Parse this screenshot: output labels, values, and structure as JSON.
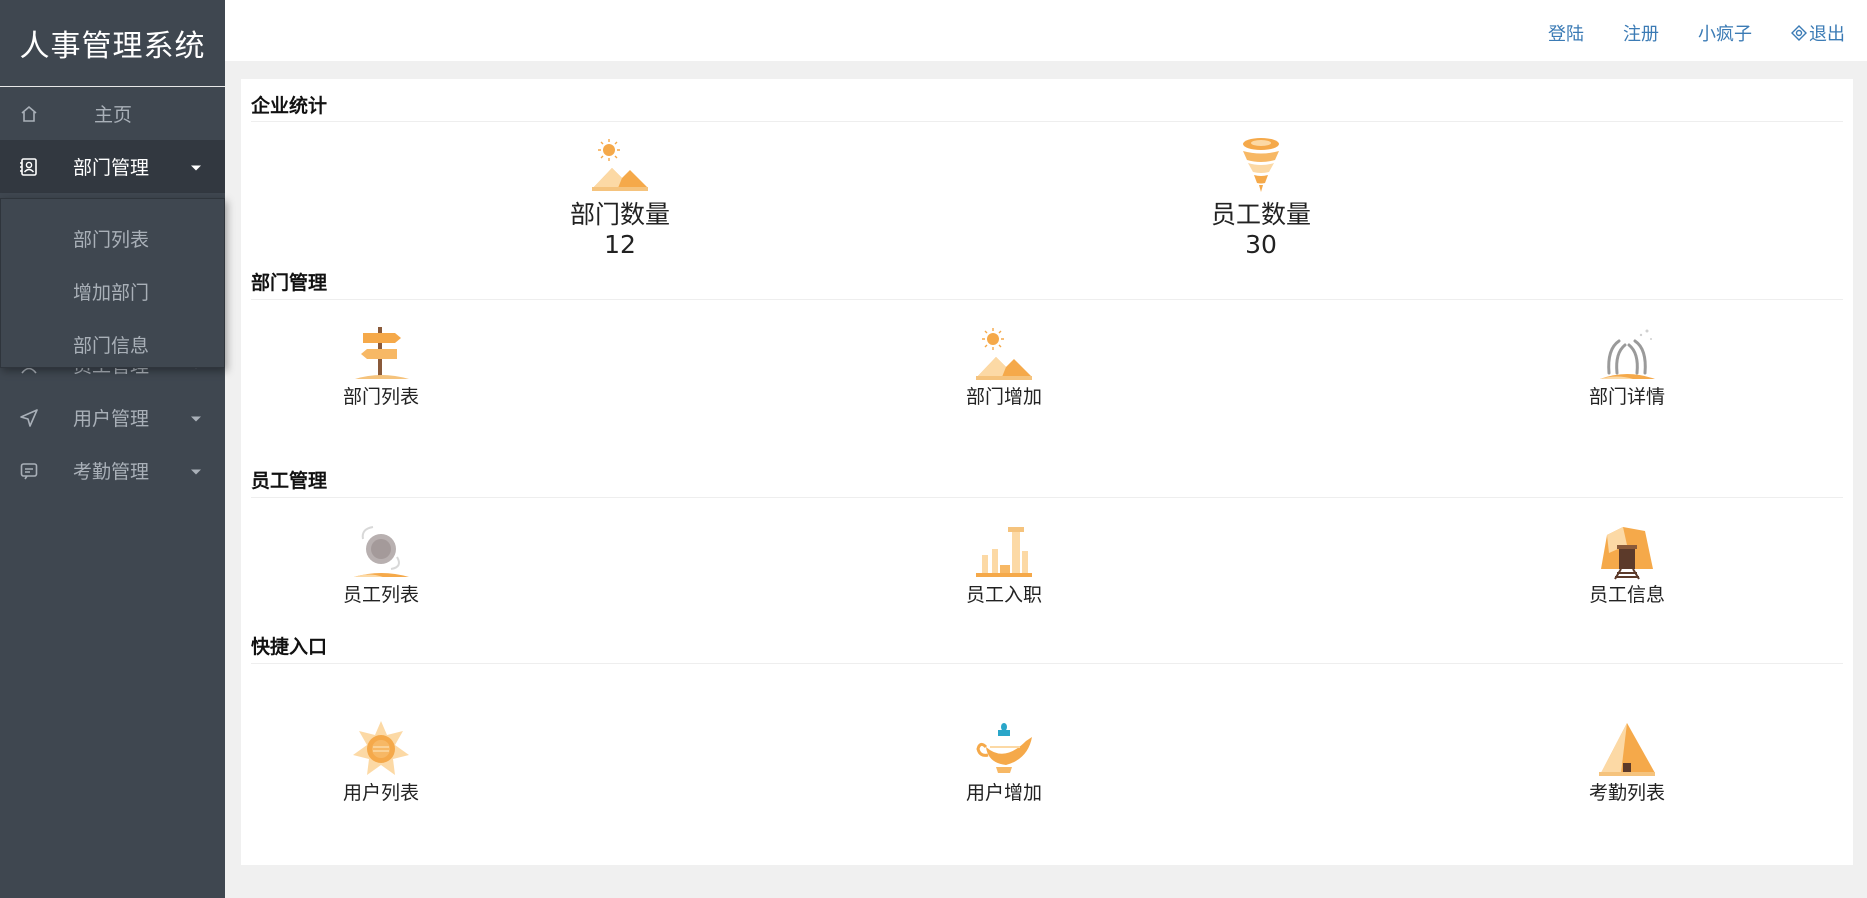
{
  "app": {
    "title": "人事管理系统"
  },
  "sidebar": {
    "items": [
      {
        "label": "主页",
        "icon": "home-icon"
      },
      {
        "label": "部门管理",
        "icon": "contact-card-icon"
      },
      {
        "label": "员工管理",
        "icon": "user-icon"
      },
      {
        "label": "用户管理",
        "icon": "send-icon"
      },
      {
        "label": "考勤管理",
        "icon": "message-icon"
      }
    ],
    "submenu": [
      "部门列表",
      "增加部门",
      "部门信息"
    ]
  },
  "topbar": {
    "login": "登陆",
    "register": "注册",
    "username": "小疯子",
    "logout": "退出"
  },
  "stats": {
    "title": "企业统计",
    "items": [
      {
        "label": "部门数量",
        "value": "12",
        "icon": "desert-sun-icon"
      },
      {
        "label": "员工数量",
        "value": "30",
        "icon": "tornado-icon"
      }
    ]
  },
  "dept": {
    "title": "部门管理",
    "items": [
      "部门列表",
      "部门增加",
      "部门详情"
    ]
  },
  "emp": {
    "title": "员工管理",
    "items": [
      "员工列表",
      "员工入职",
      "员工信息"
    ]
  },
  "quick": {
    "title": "快捷入口",
    "items": [
      "用户列表",
      "用户增加",
      "考勤列表"
    ]
  },
  "colors": {
    "sidebar": "#3f4750",
    "sidebarActive": "#323840",
    "link": "#3b7bb5",
    "iconOrange": "#f5a94a",
    "iconLight": "#fcd9a5"
  }
}
